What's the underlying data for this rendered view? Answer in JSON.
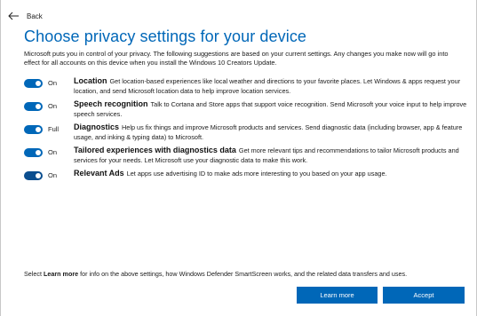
{
  "header": {
    "back_label": "Back"
  },
  "title": "Choose privacy settings for your device",
  "intro": "Microsoft puts you in control of your privacy. The following suggestions are based on your current settings. Any changes you make now will go into effect for all accounts on this device when you install the Windows 10 Creators Update.",
  "settings": [
    {
      "state": "On",
      "title": "Location",
      "text": "Get location-based experiences like local weather and directions to your favorite places. Let Windows & apps request your location, and send Microsoft location data to help improve location services."
    },
    {
      "state": "On",
      "title": "Speech recognition",
      "text": "Talk to Cortana and Store apps that support voice recognition. Send Microsoft your voice input to help improve speech services."
    },
    {
      "state": "Full",
      "title": "Diagnostics",
      "text": "Help us fix things and improve Microsoft products and services. Send diagnostic data (including browser, app & feature usage, and inking & typing data) to Microsoft."
    },
    {
      "state": "On",
      "title": "Tailored experiences with diagnostics data",
      "text": "Get more relevant tips and recommendations to tailor Microsoft products and services for your needs. Let Microsoft use your diagnostic data to make this work."
    },
    {
      "state": "On",
      "title": "Relevant Ads",
      "text": "Let apps use advertising ID to make ads more interesting to you based on your app usage."
    }
  ],
  "footer": {
    "prefix": "Select ",
    "bold": "Learn more",
    "suffix": " for info on the above settings, how Windows Defender SmartScreen works, and the related data transfers and uses."
  },
  "buttons": {
    "learn_more": "Learn more",
    "accept": "Accept"
  },
  "colors": {
    "accent": "#0067b8"
  }
}
